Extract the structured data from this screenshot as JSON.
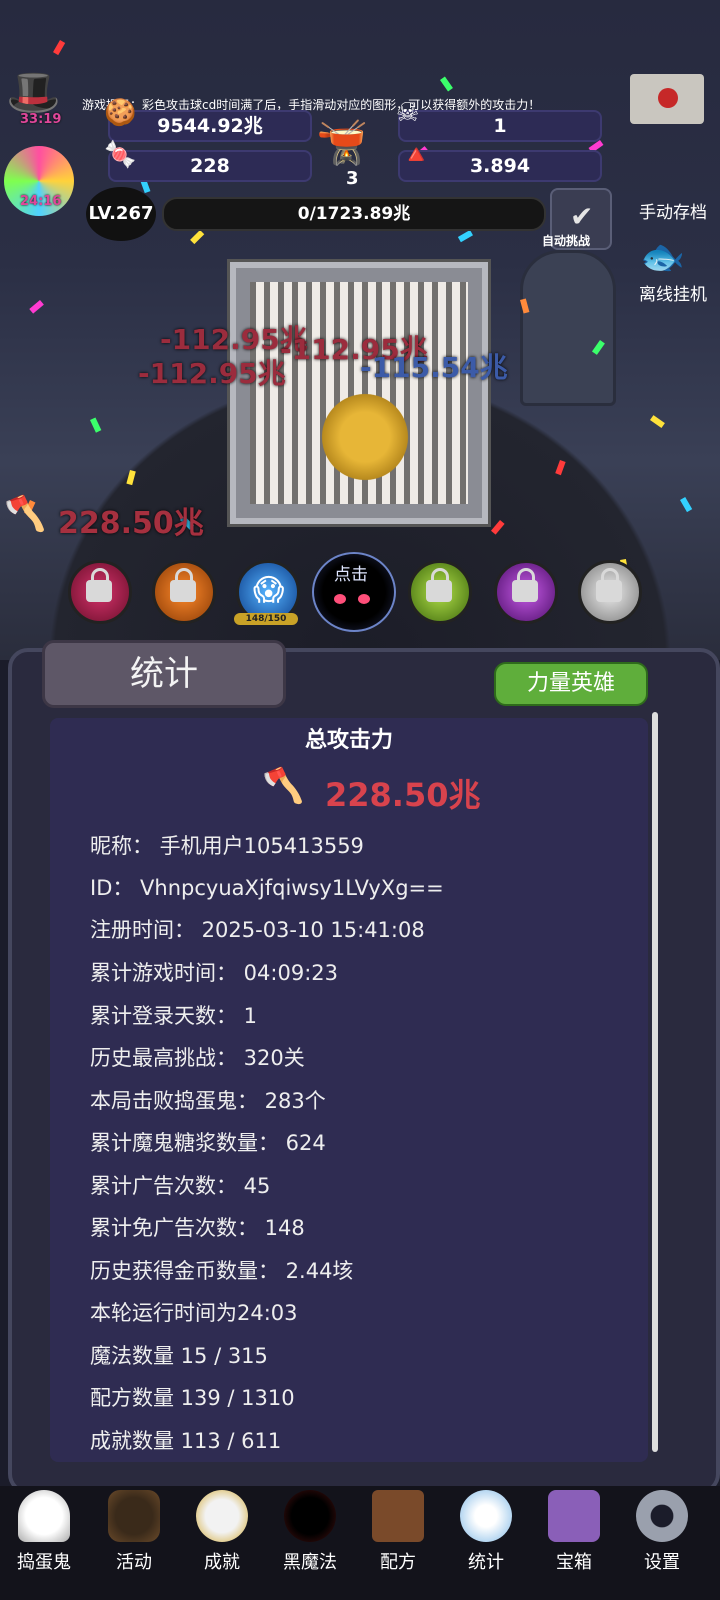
{
  "hint": "游戏提示：彩色攻击球cd时间满了后，手指滑动对应的图形，可以获得额外的攻击力！",
  "timers": {
    "hat": "33:19",
    "candy": "24:16"
  },
  "resources": {
    "sugar": "9544.92兆",
    "potion": "1",
    "candy": "228",
    "cauldron": "3",
    "corn": "3.894"
  },
  "level": "LV.267",
  "progress": "0/1723.89兆",
  "auto_challenge": "自动挑战",
  "manual_save": "手动存档",
  "offline": "离线挂机",
  "damage": [
    "-112.95兆",
    "-112.95兆",
    "-112.95兆",
    "-115.54兆"
  ],
  "attack_float": "228.50兆",
  "orb_count": "148/150",
  "click_label": "点击",
  "panel": {
    "tab": "统计",
    "hero_button": "力量英雄",
    "total_title": "总攻击力",
    "total_value": "228.50兆",
    "stats": [
      "昵称：  手机用户105413559",
      "ID：   VhnpcyuaXjfqiwsy1LVyXg==",
      "注册时间：  2025-03-10 15:41:08",
      "累计游戏时间：  04:09:23",
      "累计登录天数：  1",
      "历史最高挑战：  320关",
      "本局击败捣蛋鬼：  283个",
      "累计魔鬼糖浆数量：  624",
      "累计广告次数：  45",
      "累计免广告次数：  148",
      "历史获得金币数量：  2.44垓",
      "本轮运行时间为24:03",
      "魔法数量 15 / 315",
      "配方数量 139 / 1310",
      "成就数量 113 / 611"
    ]
  },
  "nav": [
    "捣蛋鬼",
    "活动",
    "成就",
    "黑魔法",
    "配方",
    "统计",
    "宝箱",
    "设置"
  ]
}
